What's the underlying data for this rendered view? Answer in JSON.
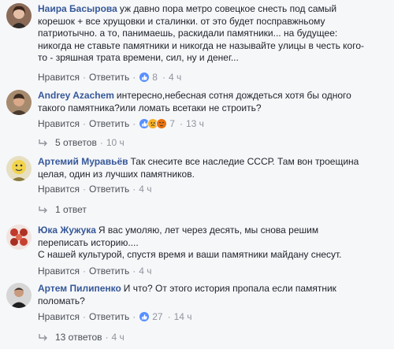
{
  "comments": [
    {
      "author": "Наира Басырова",
      "lines": [
        "уж давно пора метро совецкое снесть под самый",
        "корешок + все хрущовки и сталинки. от это будет посправжньому",
        "патриотычно. а то, панимаешь, раскидали памятники... на будущее:",
        "никогда не ставьте памятники и никогда не называйте улицы в честь кого-",
        "то - зряшная трата времени, сил, ну и денег..."
      ],
      "like_label": "Нравится",
      "reply_label": "Ответить",
      "reactions": "8",
      "time": "4 ч",
      "avatar_color": "#6b4a3a"
    },
    {
      "author": "Andrey Azachem",
      "lines": [
        "интересно,небесная сотня дождеться хотя бы одного",
        "такого памятника?или ломать всетаки не строить?"
      ],
      "like_label": "Нравится",
      "reply_label": "Ответить",
      "reactions": "7",
      "time": "13 ч",
      "replies_label": "5 ответов",
      "replies_time": "10 ч",
      "avatar_color": "#7a5a44"
    },
    {
      "author": "Артемий Муравьёв",
      "lines": [
        "Так снесите все наследие СССР. Там вон троещина",
        "целая, один из лучших памятников."
      ],
      "like_label": "Нравится",
      "reply_label": "Ответить",
      "time": "4 ч",
      "replies_label": "1 ответ",
      "avatar_color": "#c8b04a"
    },
    {
      "author": "Юка Жужука",
      "lines": [
        "Я вас умоляю, лет через десять, мы снова решим",
        "переписать историю....",
        "С нашей культурой, спустя время и ваши памятники майдану снесут."
      ],
      "like_label": "Нравится",
      "reply_label": "Ответить",
      "time": "4 ч",
      "avatar_color": "#c0392b"
    },
    {
      "author": "Артем Пилипенко",
      "lines": [
        "И что? От этого история пропала если памятник",
        "поломать?"
      ],
      "like_label": "Нравится",
      "reply_label": "Ответить",
      "reactions": "27",
      "time": "14 ч",
      "replies_label": "13 ответов",
      "replies_time": "4 ч",
      "avatar_color": "#3d3d3d"
    }
  ],
  "colors": {
    "author": "#365899",
    "action": "#4b4f56",
    "meta": "#90949c",
    "like": "#5890ff",
    "sad": "#f7b125",
    "angry": "#e9710f"
  }
}
